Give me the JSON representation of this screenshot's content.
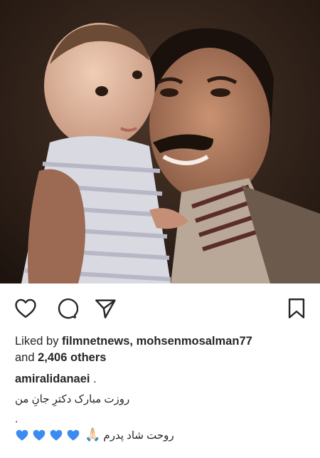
{
  "post": {
    "image": {
      "description_icon": "photo-image"
    },
    "actions": {
      "like_icon": "heart-icon",
      "comment_icon": "comment-icon",
      "share_icon": "send-icon",
      "save_icon": "bookmark-icon"
    },
    "likes": {
      "prefix": "Liked by ",
      "users": "filmnetnews, mohsenmosalman77",
      "and": "and ",
      "count": "2,406 others"
    },
    "caption": {
      "username": "amiralidanaei",
      "separator": " .",
      "line1": "روزت مبارک دکترِ جانِ من",
      "line2": ".",
      "line3_text": "روحت شاد پدرم",
      "emoji_hands": "🙏🏻",
      "heart_color": "#3b8cf0",
      "hearts": [
        "blue-heart",
        "blue-heart",
        "blue-heart",
        "blue-heart"
      ]
    }
  }
}
